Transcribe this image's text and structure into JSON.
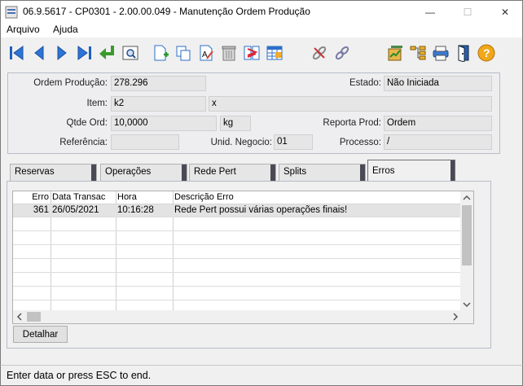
{
  "window": {
    "title": "06.9.5617 - CP0301 - 2.00.00.049 - Manutenção Ordem Produção",
    "minimize": "—",
    "maximize": "☐",
    "close": "✕"
  },
  "menu": [
    "Arquivo",
    "Ajuda"
  ],
  "toolbar": {
    "icons": [
      "first-icon",
      "prev-icon",
      "next-icon",
      "last-icon",
      "return-icon",
      "zoom-icon",
      "new-icon",
      "copy-icon",
      "edit-icon",
      "delete-icon",
      "undo-icon",
      "query-icon",
      "link-icon",
      "chain-icon",
      "report-icon",
      "tree-icon",
      "print-icon",
      "exit-icon",
      "help-icon"
    ]
  },
  "form": {
    "ordem_label": "Ordem Produção:",
    "ordem_value": "278.296",
    "estado_label": "Estado:",
    "estado_value": "Não Iniciada",
    "item_label": "Item:",
    "item_value": "k2",
    "item_desc": "x",
    "qtde_label": "Qtde Ord:",
    "qtde_value": "10,0000",
    "unidade_value": "kg",
    "reporta_label": "Reporta Prod:",
    "reporta_value": "Ordem",
    "referencia_label": "Referência:",
    "referencia_value": "",
    "unid_negocio_label": "Unid. Negocio:",
    "unid_negocio_value": "01",
    "processo_label": "Processo:",
    "processo_value": "/"
  },
  "tabs": [
    "Reservas",
    "Operações",
    "Rede Pert",
    "Splits",
    "Erros"
  ],
  "active_tab": "Erros",
  "grid": {
    "columns": [
      "Erro",
      "Data Transac",
      "Hora",
      "Descrição Erro"
    ],
    "rows": [
      {
        "erro": "361",
        "data": "26/05/2021",
        "hora": "10:16:28",
        "descricao": "Rede Pert possui várias operações finais!"
      }
    ]
  },
  "buttons": {
    "detalhar": "Detalhar"
  },
  "status": "Enter data or press ESC to end."
}
